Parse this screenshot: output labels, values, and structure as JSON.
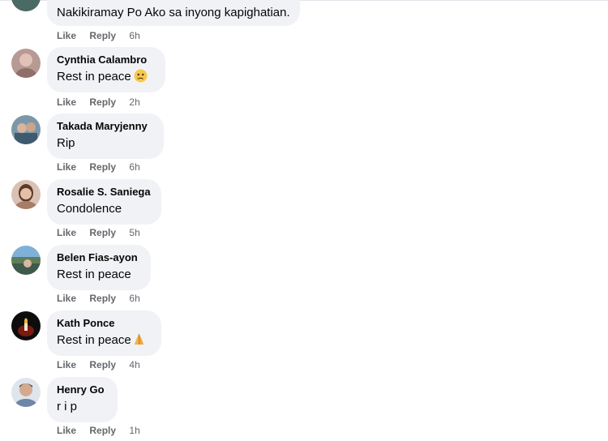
{
  "comments": [
    {
      "author": "",
      "text": "Nakikiramay Po Ako sa inyong kapighatian.",
      "emoji": "",
      "like": "Like",
      "reply": "Reply",
      "time": "6h"
    },
    {
      "author": "Cynthia Calambro",
      "text": "Rest in peace",
      "emoji": "crying-face",
      "like": "Like",
      "reply": "Reply",
      "time": "2h"
    },
    {
      "author": "Takada Maryjenny",
      "text": "Rip",
      "emoji": "",
      "like": "Like",
      "reply": "Reply",
      "time": "6h"
    },
    {
      "author": "Rosalie S. Saniega",
      "text": "Condolence",
      "emoji": "",
      "like": "Like",
      "reply": "Reply",
      "time": "5h"
    },
    {
      "author": "Belen Fias-ayon",
      "text": "Rest in peace",
      "emoji": "",
      "like": "Like",
      "reply": "Reply",
      "time": "6h"
    },
    {
      "author": "Kath Ponce",
      "text": "Rest in peace",
      "emoji": "praying-hands",
      "like": "Like",
      "reply": "Reply",
      "time": "4h"
    },
    {
      "author": "Henry Go",
      "text": "r i p",
      "emoji": "",
      "like": "Like",
      "reply": "Reply",
      "time": "1h"
    }
  ]
}
